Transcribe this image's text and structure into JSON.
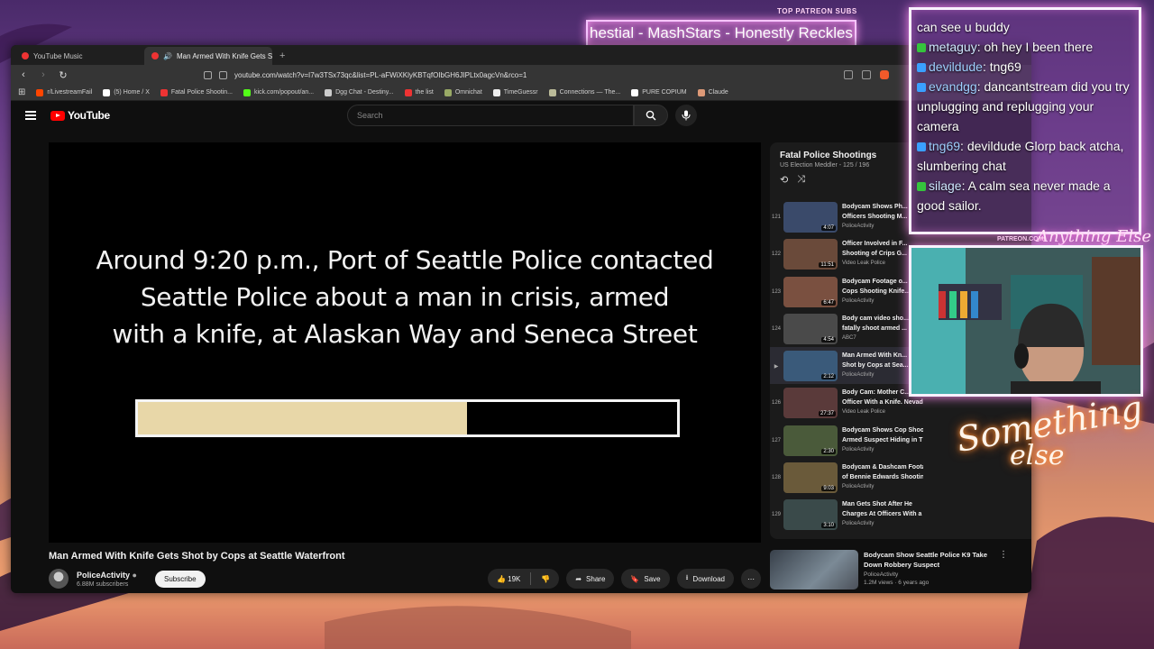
{
  "overlay": {
    "patreon_label": "TOP PATREON SUBS",
    "ticker_text": "hestial - MashStars - Honestly Reckles",
    "patreon_url": "PATREON.COM/",
    "signature_top": "Anything Else",
    "neon_line1": "Something",
    "neon_line2": "else"
  },
  "chat": [
    {
      "user": "",
      "text": "can see u buddy",
      "badge_color": ""
    },
    {
      "user": "metaguy",
      "text": ": oh hey I been there",
      "badge_color": "#35c43d"
    },
    {
      "user": "devildude",
      "text": ": tng69",
      "badge_color": "#3aa0ff"
    },
    {
      "user": "evandgg",
      "text": ": dancantstream did you try unplugging and replugging your camera",
      "badge_color": "#3aa0ff"
    },
    {
      "user": "tng69",
      "text": ": devildude Glorp back atcha, slumbering chat",
      "badge_color": "#3aa0ff"
    },
    {
      "user": "silage",
      "text": ": A calm sea never made a good sailor.",
      "badge_color": "#35c43d"
    }
  ],
  "browser": {
    "tabs": [
      {
        "label": "YouTube Music",
        "active": false
      },
      {
        "label": "Man Armed With Knife Gets S",
        "active": true
      }
    ],
    "url": "youtube.com/watch?v=I7w3TSx73qc&list=PL-aFWiXKlyKBTqfOIbGH6JIPLtx0agcVn&rco=1",
    "bookmarks": [
      "r/LivestreamFail",
      "(5) Home / X",
      "Fatal Police Shootin...",
      "kick.com/popout/an...",
      "Dgg Chat - Destiny...",
      "the list",
      "Omnichat",
      "TimeGuessr",
      "Connections — The...",
      "PURE COPIUM",
      "Claude"
    ]
  },
  "youtube": {
    "logo": "YouTube",
    "search_placeholder": "Search",
    "caption_lines": [
      "Around 9:20 p.m., Port of Seattle Police contacted",
      "Seattle Police about a man in crisis, armed",
      "with a knife, at Alaskan Way and Seneca Street"
    ],
    "progress_fraction": 0.61,
    "video_title": "Man Armed With Knife Gets Shot by Cops at Seattle Waterfront",
    "channel_name": "PoliceActivity",
    "channel_subs": "6.88M subscribers",
    "subscribe_label": "Subscribe",
    "likes": "19K",
    "share_label": "Share",
    "save_label": "Save",
    "download_label": "Download"
  },
  "playlist": {
    "title": "Fatal Police Shootings",
    "subtitle": "US Election Meddler - 125 / 196",
    "items": [
      {
        "idx": "121",
        "title": "Bodycam Shows Ph...",
        "title2": "Officers Shooting M...",
        "channel": "PoliceActivity",
        "duration": "4:07",
        "thumb": "#3a4a6a",
        "current": false
      },
      {
        "idx": "122",
        "title": "Officer Involved in F...",
        "title2": "Shooting of Crips G...",
        "channel": "Video Leak Police",
        "duration": "11:51",
        "thumb": "#6a4a3a",
        "current": false
      },
      {
        "idx": "123",
        "title": "Bodycam Footage o...",
        "title2": "Cops Shooting Knife...",
        "channel": "PoliceActivity",
        "duration": "6:47",
        "thumb": "#7a5040",
        "current": false
      },
      {
        "idx": "124",
        "title": "Body cam video sho...",
        "title2": "fatally shoot armed ...",
        "channel": "ABC7",
        "duration": "4:54",
        "thumb": "#4a4a4a",
        "current": false
      },
      {
        "idx": "",
        "title": "Man Armed With Kn...",
        "title2": "Shot by Cops at Sea...",
        "channel": "PoliceActivity",
        "duration": "2:12",
        "thumb": "#3a5a7a",
        "current": true
      },
      {
        "idx": "126",
        "title": "Body Cam: Mother C...",
        "title2": "Officer With a Knife. Nevada...",
        "channel": "Video Leak Police",
        "duration": "27:37",
        "thumb": "#5a3a3a",
        "current": false
      },
      {
        "idx": "127",
        "title": "Bodycam Shows Cop Shooting",
        "title2": "Armed Suspect Hiding in The...",
        "channel": "PoliceActivity",
        "duration": "2:30",
        "thumb": "#4a5a3a",
        "current": false
      },
      {
        "idx": "128",
        "title": "Bodycam & Dashcam Footage",
        "title2": "of Bennie Edwards Shooting",
        "channel": "PoliceActivity",
        "duration": "9:03",
        "thumb": "#6a5a3a",
        "current": false
      },
      {
        "idx": "129",
        "title": "Man Gets Shot After He",
        "title2": "Charges At Officers With a Gu...",
        "channel": "PoliceActivity",
        "duration": "3:10",
        "thumb": "#3a4a4a",
        "current": false
      }
    ]
  },
  "recommendation": {
    "title": "Bodycam Show Seattle Police K9 Take Down Robbery Suspect",
    "channel": "PoliceActivity",
    "views": "1.2M views · 6 years ago"
  }
}
